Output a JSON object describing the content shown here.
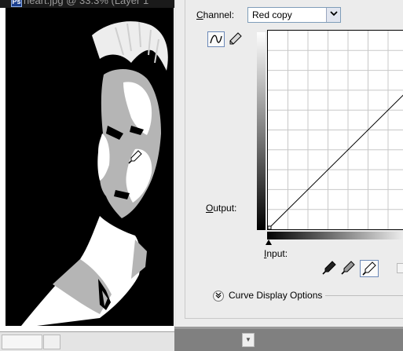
{
  "document": {
    "title": "heart.jpg @ 33.3% (Layer 1",
    "app_icon_letter": "Ps"
  },
  "curves": {
    "channel_label": "Channel:",
    "channel_mnemonic": "C",
    "channel_rest": "hannel:",
    "channel_value": "Red copy",
    "output_label": "Output:",
    "output_mnemonic": "O",
    "output_rest": "utput:",
    "input_label": "Input:",
    "input_mnemonic": "I",
    "input_rest": "nput:",
    "sample_label": "S",
    "curve_display_options": "Curve Display Options",
    "tools": [
      "curve-point-tool",
      "pencil-tool"
    ],
    "eyedroppers": [
      "black-point",
      "gray-point",
      "white-point"
    ],
    "graph": {
      "grid_divisions": 10,
      "curve": [
        [
          0,
          0
        ],
        [
          255,
          255
        ]
      ]
    }
  },
  "colors": {
    "dialog_bg": "#ececec",
    "grid": "#c8c8c8",
    "selection_border": "#6c89b8",
    "select_border": "#7f9db9"
  }
}
